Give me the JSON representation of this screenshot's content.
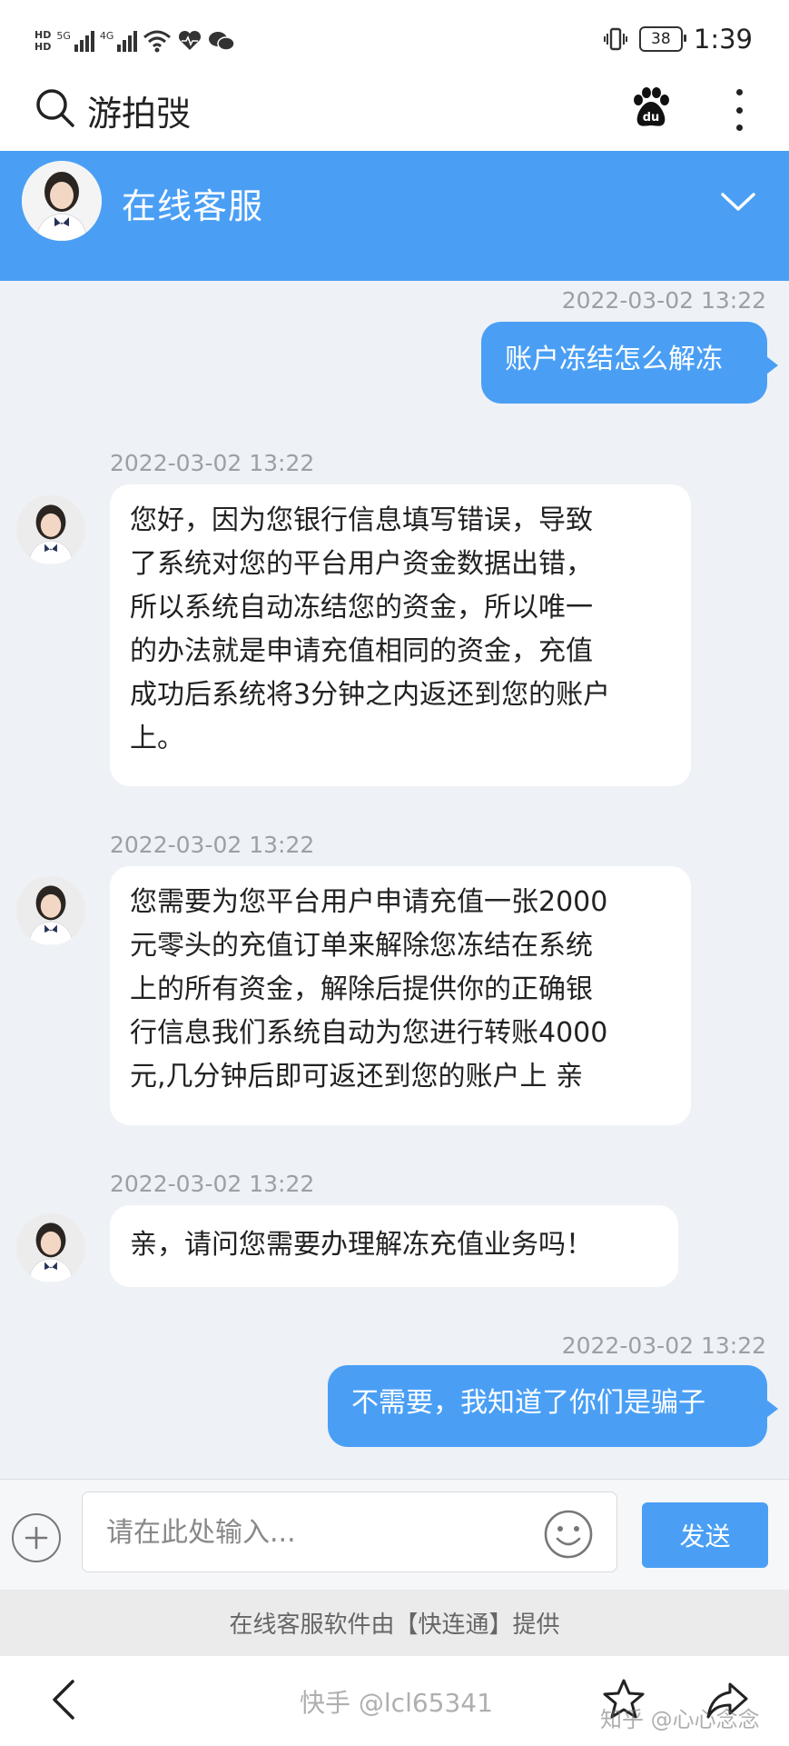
{
  "status_bar": {
    "hd_top": "HD",
    "hd_bottom": "HD",
    "net1": "5G",
    "net2": "4G",
    "battery": "38",
    "time": "1:39"
  },
  "search_bar": {
    "title": "游拍弢",
    "search_icon": "search-icon",
    "baidu_icon": "baidu-paw-icon",
    "menu_icon": "more-vertical-icon"
  },
  "chat_header": {
    "title": "在线客服",
    "chevron_icon": "chevron-down-icon"
  },
  "messages": [
    {
      "side": "right",
      "time": "2022-03-02 13:22",
      "text": "账户冻结怎么解冻"
    },
    {
      "side": "left",
      "time": "2022-03-02 13:22",
      "lines": [
        "您好，因为您银行信息填写错误，导致",
        "了系统对您的平台用户资金数据出错，",
        "所以系统自动冻结您的资金，所以唯一",
        "的办法就是申请充值相同的资金，充值",
        "成功后系统将3分钟之内返还到您的账户",
        "上。"
      ]
    },
    {
      "side": "left",
      "time": "2022-03-02 13:22",
      "lines": [
        "您需要为您平台用户申请充值一张2000",
        "元零头的充值订单来解除您冻结在系统",
        "上的所有资金，解除后提供你的正确银",
        "行信息我们系统自动为您进行转账4000",
        "元,几分钟后即可返还到您的账户上 亲"
      ]
    },
    {
      "side": "left",
      "time": "2022-03-02 13:22",
      "text": "亲，请问您需要办理解冻充值业务吗！"
    },
    {
      "side": "right",
      "time": "2022-03-02 13:22",
      "text": "不需要，我知道了你们是骗子"
    }
  ],
  "input_area": {
    "placeholder": "请在此处输入...",
    "value": "",
    "send_label": "发送"
  },
  "provider_text": "在线客服软件由【快连通】提供",
  "watermarks": {
    "left": "快手 @lcl65341",
    "right": "知乎 @心心念念"
  },
  "colors": {
    "accent": "#4a9ff5",
    "background": "#eef1f6",
    "timestamp": "#9aa0a8"
  }
}
